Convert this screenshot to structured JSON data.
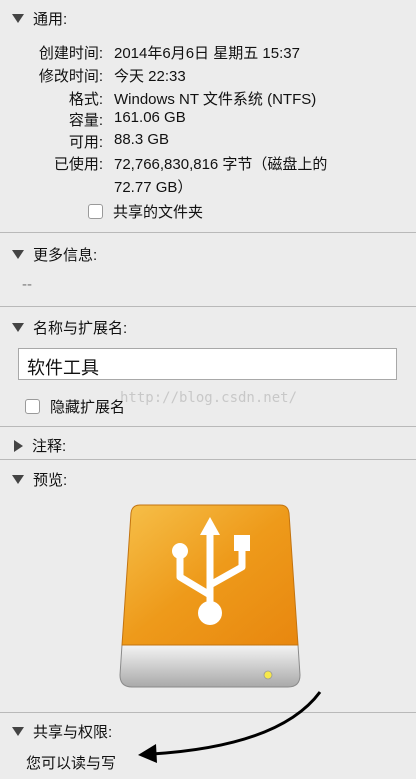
{
  "general": {
    "title": "通用:",
    "rows": [
      {
        "label": "创建时间:",
        "value": "2014年6月6日 星期五 15:37"
      },
      {
        "label": "修改时间:",
        "value": "今天 22:33"
      },
      {
        "label": "格式:",
        "value": "Windows NT 文件系统 (NTFS)"
      },
      {
        "label": "容量:",
        "value": "161.06 GB"
      },
      {
        "label": "可用:",
        "value": "88.3 GB"
      },
      {
        "label": "已使用:",
        "value": "72,766,830,816 字节（磁盘上的"
      }
    ],
    "used_cont": "72.77 GB）",
    "shared_folder_label": "共享的文件夹"
  },
  "more_info": {
    "title": "更多信息:",
    "value": "--"
  },
  "name_ext": {
    "title": "名称与扩展名:",
    "name_value": "软件工具",
    "hide_ext_label": "隐藏扩展名"
  },
  "comments": {
    "title": "注释:"
  },
  "preview": {
    "title": "预览:",
    "icon": "usb-drive-icon",
    "accent": "#f0a020"
  },
  "sharing": {
    "title": "共享与权限:",
    "permission": "您可以读与写"
  },
  "watermark": "http://blog.csdn.net/"
}
